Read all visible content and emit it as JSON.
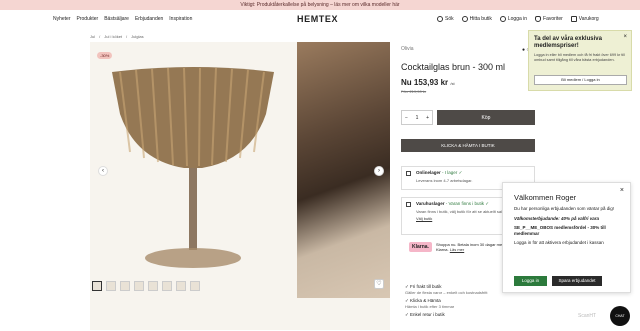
{
  "banner": {
    "text": "Viktigt: Produktåterkallelse på belysning – läs mer om vilka modeller här"
  },
  "header": {
    "logo": "HEMTEX",
    "nav": [
      "Nyheter",
      "Produkter",
      "Bästsäljare",
      "Erbjudanden",
      "Inspiration"
    ],
    "utils": {
      "search": "Sök",
      "store": "Hitta butik",
      "login": "Logga in",
      "favorites": "Favoriter",
      "cart": "Varukorg"
    }
  },
  "breadcrumb": [
    "Jul",
    "Jul i köket",
    "Julglas"
  ],
  "gallery": {
    "badge": "-30%",
    "prev": "‹",
    "next": "›",
    "thumb_count": 8
  },
  "product": {
    "brand": "Olivia",
    "dots": "● ○",
    "title": "Cocktailglas brun - 300 ml",
    "price": "Nu 153,93 kr",
    "price_unit": "/st",
    "old_price": "Förr 219,90 kr",
    "qty": "1",
    "qty_minus": "−",
    "qty_plus": "+",
    "buy_label": "Köp",
    "cc_label": "KLICKA & HÄMTA I BUTIK"
  },
  "stock": {
    "online_title": "Onlinelager",
    "online_status": "- I lager",
    "online_note": "Leverans inom 4-7 arbetsdagar.",
    "store_title": "Varuhuslager",
    "store_status": "- Varan finns i butik",
    "store_note": "Varan finns i butik, välj butik för att se aktuellt saldo",
    "store_link": "Välj butik"
  },
  "klarna": {
    "logo": "Klarna.",
    "text": "Shoppa nu. Betala inom 30 dagar med Klarna.",
    "link": "Läs mer"
  },
  "usps": [
    {
      "title": "Fri frakt till butik",
      "sub": "Gäller de flesta varor – enkelt och kostnadsfritt"
    },
    {
      "title": "Klicka & Hämta",
      "sub": "Hämta i butik efter 3 timmar"
    },
    {
      "title": "Enkel retur i butik",
      "sub": ""
    }
  ],
  "member_popup": {
    "title": "Ta del av våra exklusiva medlemspriser!",
    "body": "Logga in eller bli medlem och få fri frakt över 699 kr till ombud samt tillgång till våra bästa erbjudanden.",
    "button": "Bli medlem / Logga in",
    "close": "×"
  },
  "offer_popup": {
    "title": "Välkommen Roger",
    "p1": "Du har personliga erbjudanden som väntar på dig!",
    "p2": "Välkomsterbjudande: 40% på valfri vara",
    "p3": "SE_P__ME_OBOS medlemsfördel - 30% till medlemmar",
    "p4": "Logga in för att aktivera erbjudandet i kassan",
    "login_btn": "Logga in",
    "save_btn": "Spara erbjudandet",
    "close": "×"
  },
  "chat": {
    "label": "CHAT"
  },
  "watermark": "ScanHT"
}
